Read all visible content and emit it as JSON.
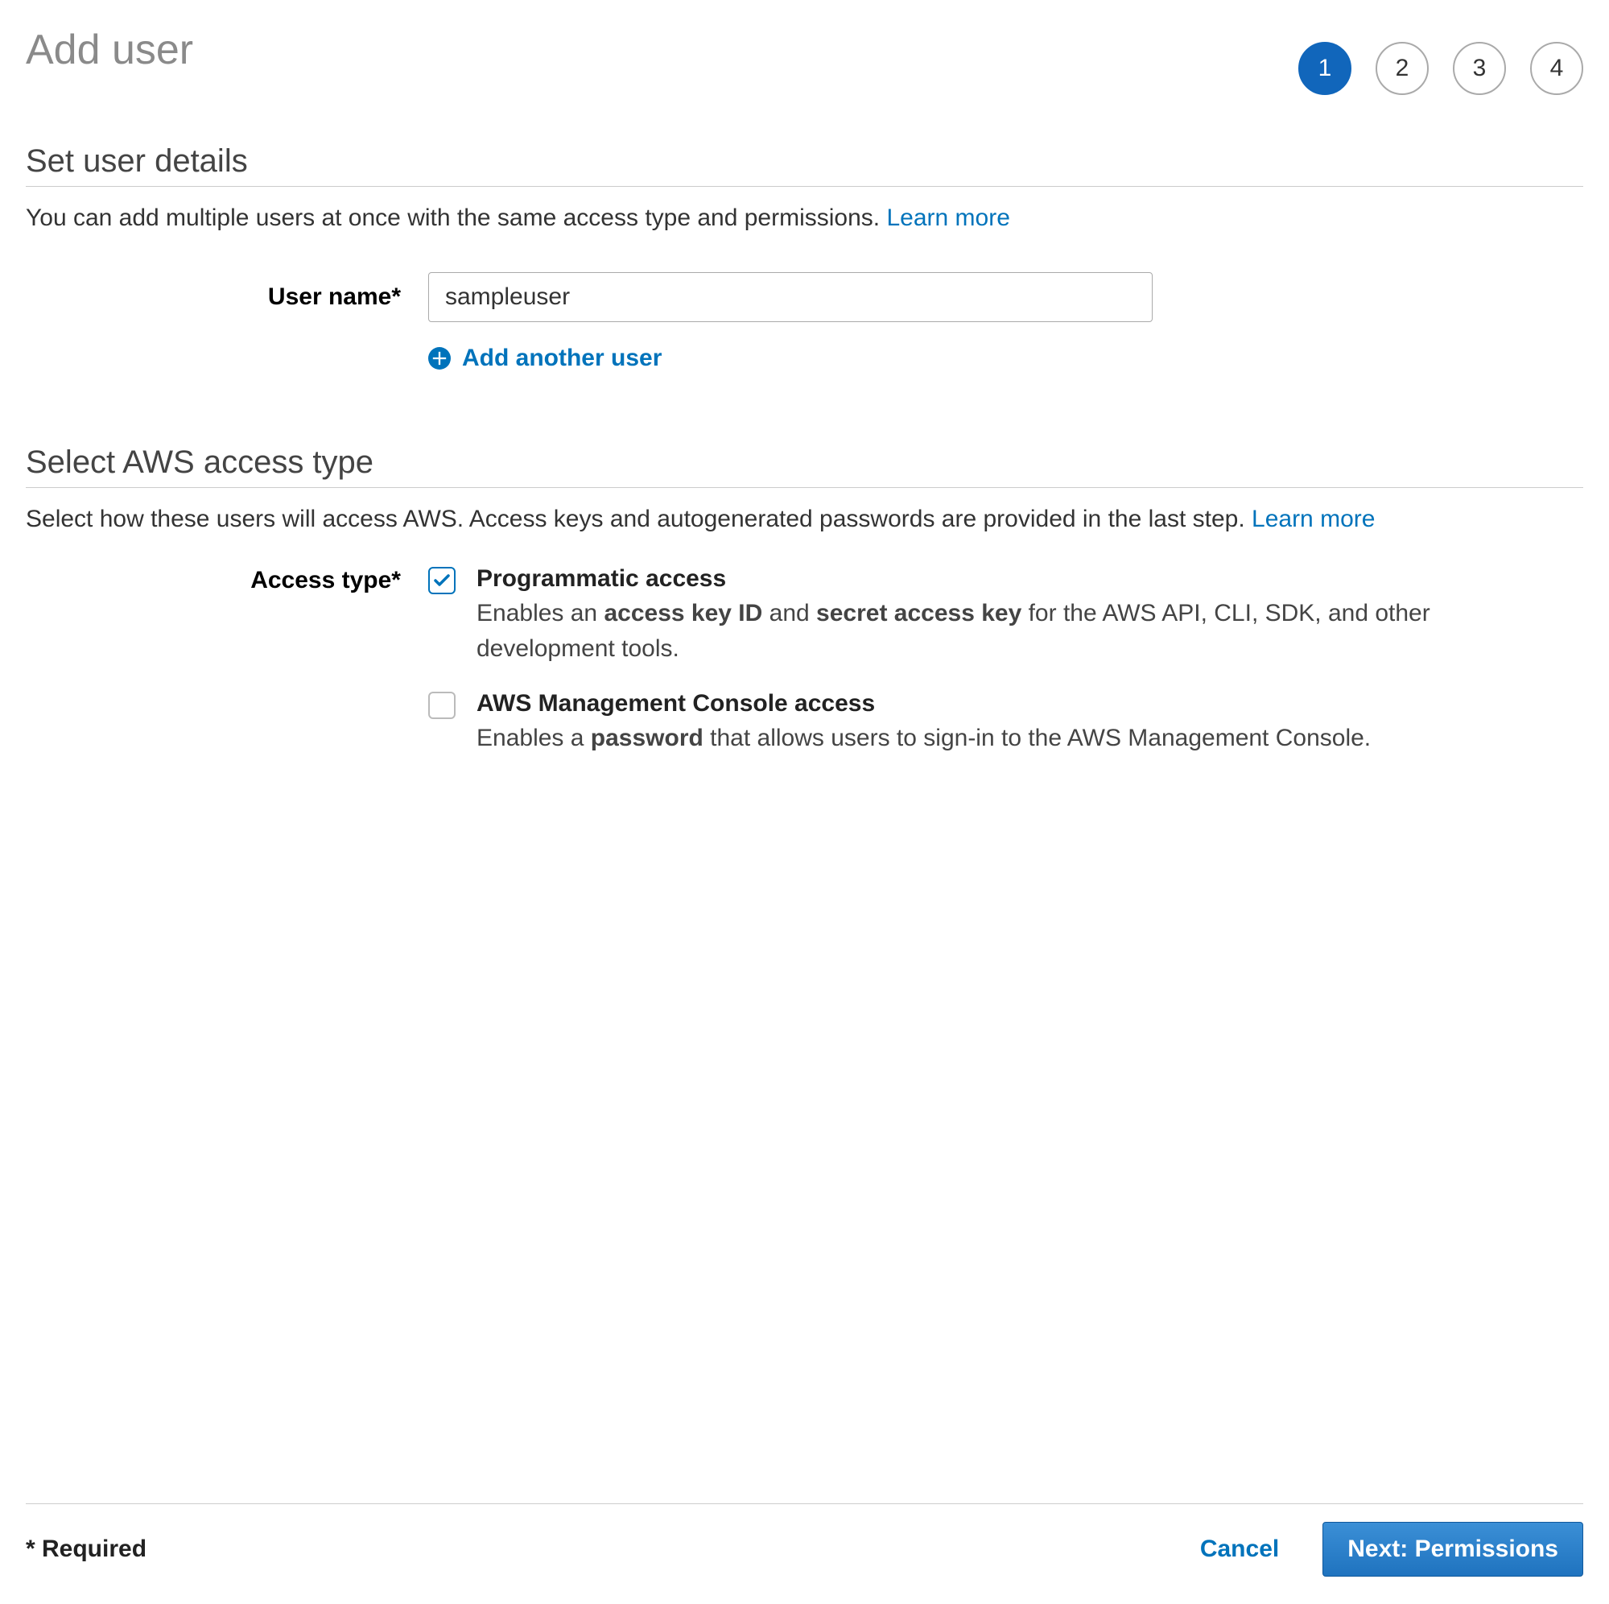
{
  "header": {
    "title": "Add user",
    "steps": [
      "1",
      "2",
      "3",
      "4"
    ],
    "active_step_index": 0
  },
  "user_details": {
    "section_title": "Set user details",
    "desc_text": "You can add multiple users at once with the same access type and permissions. ",
    "learn_more": "Learn more",
    "username_label": "User name*",
    "username_value": "sampleuser",
    "add_another_label": "Add another user"
  },
  "access_type": {
    "section_title": "Select AWS access type",
    "desc_text": "Select how these users will access AWS. Access keys and autogenerated passwords are provided in the last step. ",
    "learn_more": "Learn more",
    "label": "Access type*",
    "programmatic": {
      "checked": true,
      "title": "Programmatic access",
      "desc_pre": "Enables an ",
      "desc_b1": "access key ID",
      "desc_mid": " and ",
      "desc_b2": "secret access key",
      "desc_post": " for the AWS API, CLI, SDK, and other development tools."
    },
    "console": {
      "checked": false,
      "title": "AWS Management Console access",
      "desc_pre": "Enables a ",
      "desc_b1": "password",
      "desc_post": " that allows users to sign-in to the AWS Management Console."
    }
  },
  "footer": {
    "required_note": "* Required",
    "cancel_label": "Cancel",
    "next_label": "Next: Permissions"
  }
}
